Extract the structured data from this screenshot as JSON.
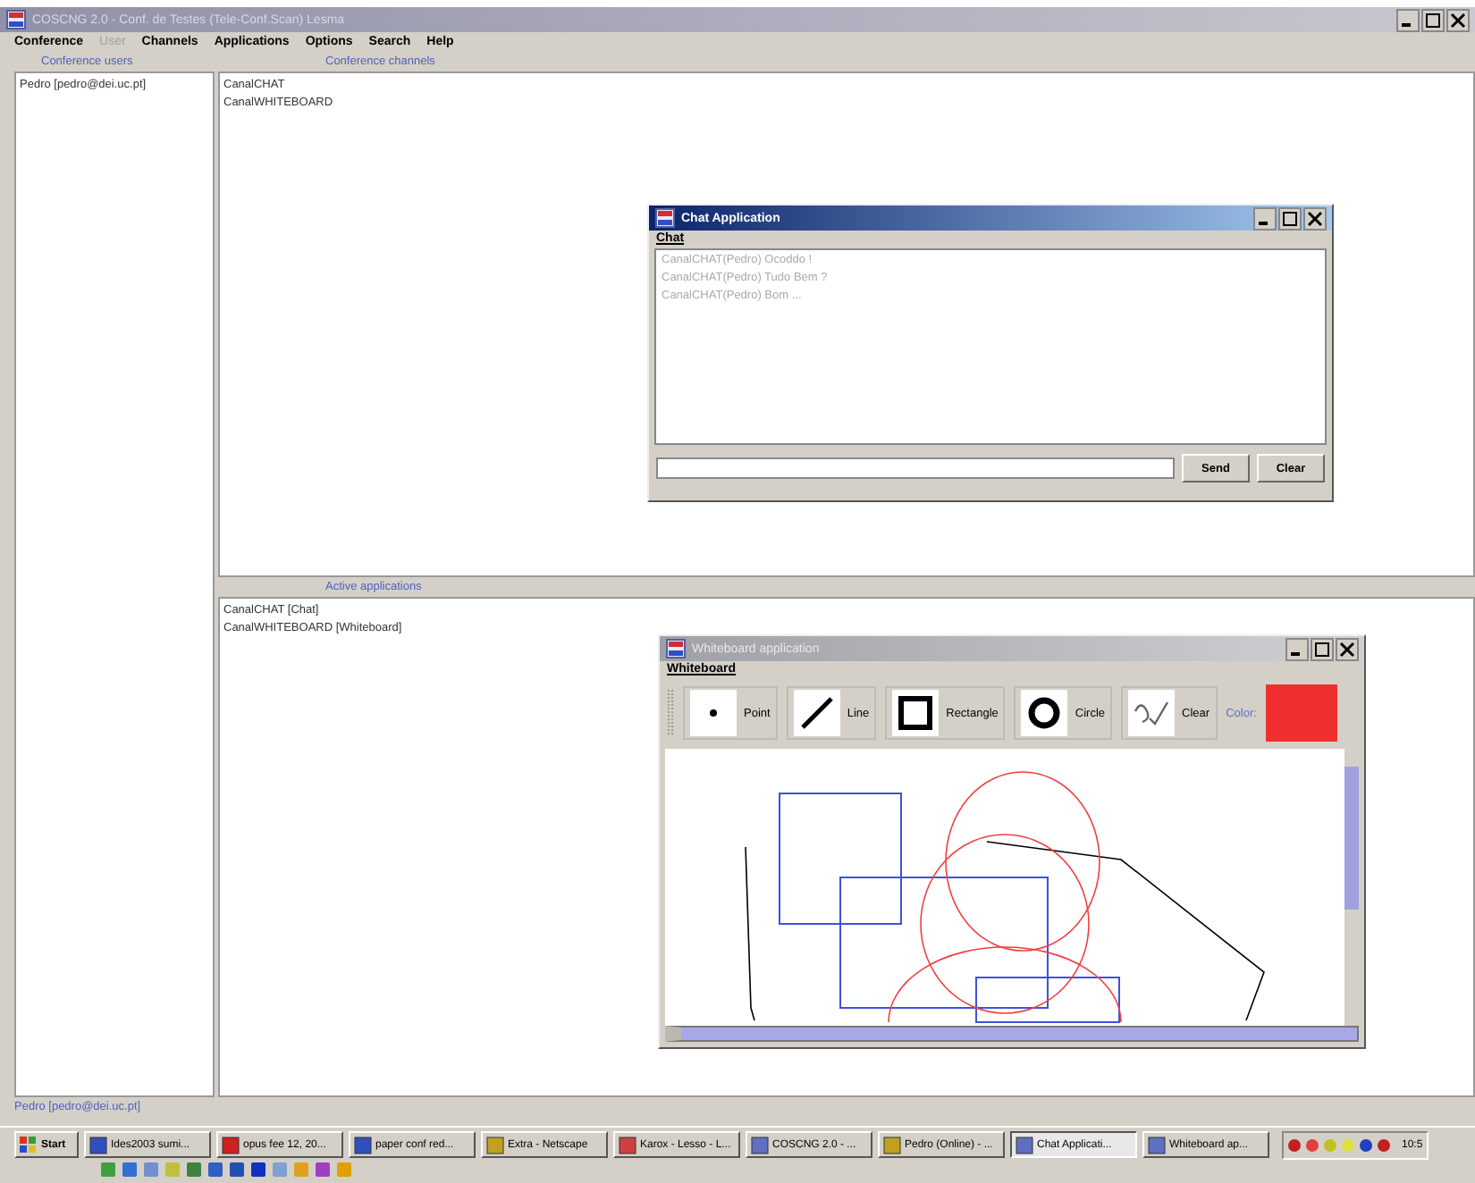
{
  "window": {
    "title": "COSCNG 2.0 - Conf. de Testes (Tele-Conf.Scan) Lesma"
  },
  "menu": [
    {
      "label": "Conference",
      "disabled": false
    },
    {
      "label": "User",
      "disabled": true
    },
    {
      "label": "Channels",
      "disabled": false
    },
    {
      "label": "Applications",
      "disabled": false
    },
    {
      "label": "Options",
      "disabled": false
    },
    {
      "label": "Search",
      "disabled": false
    },
    {
      "label": "Help",
      "disabled": false
    }
  ],
  "users": {
    "header": "Conference users",
    "items": [
      "Pedro [pedro@dei.uc.pt]"
    ]
  },
  "channels": {
    "header": "Conference channels",
    "items": [
      "CanalCHAT",
      "CanalWHITEBOARD"
    ]
  },
  "applications": {
    "header": "Active applications",
    "items": [
      "CanalCHAT [Chat]",
      "CanalWHITEBOARD [Whiteboard]"
    ]
  },
  "chat_window": {
    "title": "Chat Application",
    "active": true,
    "menu": "Chat",
    "messages": [
      "CanalCHAT(Pedro) Ocoddo !",
      "CanalCHAT(Pedro) Tudo Bem ?",
      "CanalCHAT(Pedro) Bom ..."
    ],
    "buttons": [
      "Send",
      "Clear"
    ]
  },
  "whiteboard_window": {
    "title": "Whiteboard application",
    "active": false,
    "menu": "Whiteboard",
    "tools": [
      {
        "kind": "point",
        "label": "Point"
      },
      {
        "kind": "line",
        "label": "Line"
      },
      {
        "kind": "rectangle",
        "label": "Rectangle"
      },
      {
        "kind": "circle",
        "label": "Circle"
      },
      {
        "kind": "clear",
        "label": "Clear"
      }
    ],
    "color_label": "Color:",
    "color": "#f03030"
  },
  "status_bar": "Pedro [pedro@dei.uc.pt]",
  "taskbar": {
    "start": "Start",
    "tasks": [
      {
        "label": "Ides2003 sumi...",
        "selected": false
      },
      {
        "label": "opus fee 12, 20...",
        "selected": false
      },
      {
        "label": "paper conf red...",
        "selected": false
      },
      {
        "label": "Extra - Netscape",
        "selected": false
      },
      {
        "label": "Karox - Lesso - L...",
        "selected": false
      },
      {
        "label": "COSCNG 2.0 - ...",
        "selected": false
      },
      {
        "label": "Pedro (Online) - ...",
        "selected": false
      },
      {
        "label": "Chat Applicati...",
        "selected": true
      },
      {
        "label": "Whiteboard ap...",
        "selected": false
      }
    ],
    "clock": "10:5"
  }
}
